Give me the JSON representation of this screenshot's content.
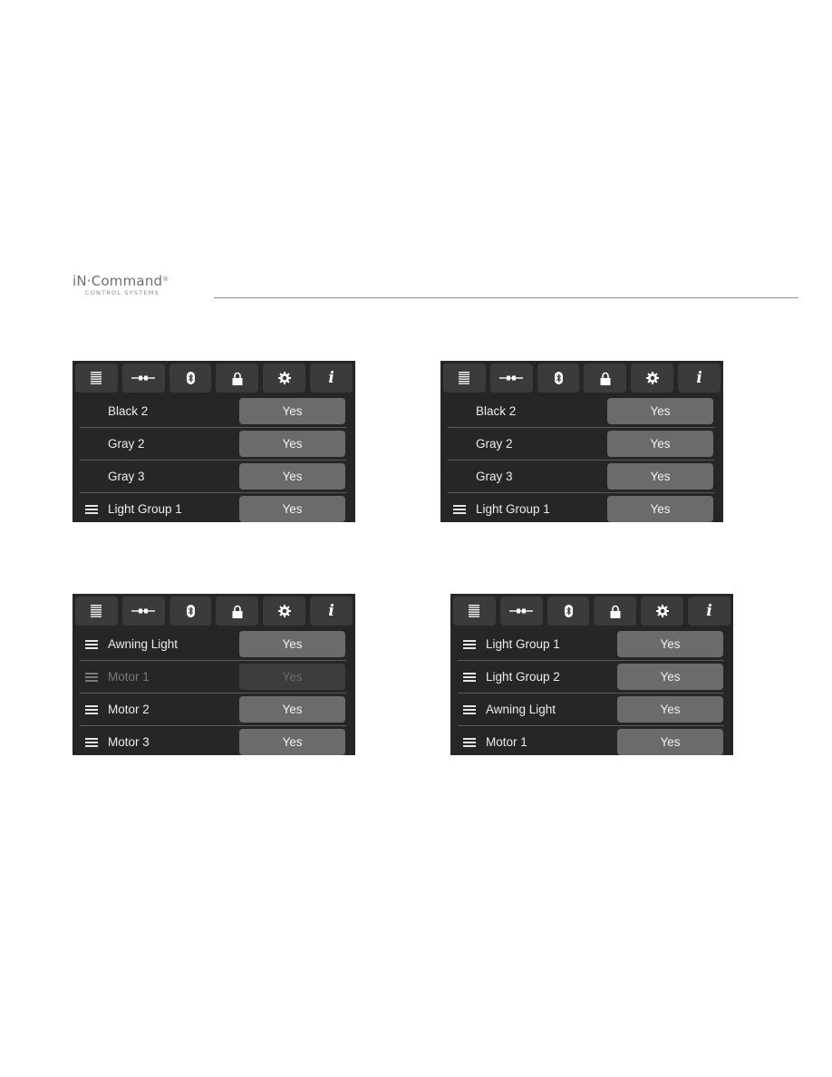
{
  "brand": {
    "name": "iN·Command",
    "registered": "®",
    "subtitle": "CONTROL SYSTEMS"
  },
  "tabs": [
    {
      "icon": "list-icon",
      "active": true
    },
    {
      "icon": "connector-icon",
      "active": false
    },
    {
      "icon": "bluetooth-icon",
      "active": false
    },
    {
      "icon": "lock-icon",
      "active": false
    },
    {
      "icon": "gear-icon",
      "active": false
    },
    {
      "icon": "info-icon",
      "glyph": "i",
      "active": false
    }
  ],
  "panels": [
    {
      "rows": [
        {
          "label": "Black 2",
          "value": "Yes",
          "has_handle": false,
          "disabled": false
        },
        {
          "label": "Gray 2",
          "value": "Yes",
          "has_handle": false,
          "disabled": false
        },
        {
          "label": "Gray 3",
          "value": "Yes",
          "has_handle": false,
          "disabled": false
        },
        {
          "label": "Light Group 1",
          "value": "Yes",
          "has_handle": true,
          "disabled": false
        }
      ]
    },
    {
      "rows": [
        {
          "label": "Black 2",
          "value": "Yes",
          "has_handle": false,
          "disabled": false
        },
        {
          "label": "Gray 2",
          "value": "Yes",
          "has_handle": false,
          "disabled": false
        },
        {
          "label": "Gray 3",
          "value": "Yes",
          "has_handle": false,
          "disabled": false
        },
        {
          "label": "Light Group 1",
          "value": "Yes",
          "has_handle": true,
          "disabled": false
        }
      ]
    },
    {
      "rows": [
        {
          "label": "Awning Light",
          "value": "Yes",
          "has_handle": true,
          "disabled": false
        },
        {
          "label": "Motor 1",
          "value": "Yes",
          "has_handle": true,
          "disabled": true
        },
        {
          "label": "Motor 2",
          "value": "Yes",
          "has_handle": true,
          "disabled": false
        },
        {
          "label": "Motor 3",
          "value": "Yes",
          "has_handle": true,
          "disabled": false
        }
      ]
    },
    {
      "rows": [
        {
          "label": "Light Group 1",
          "value": "Yes",
          "has_handle": true,
          "disabled": false
        },
        {
          "label": "Light Group 2",
          "value": "Yes",
          "has_handle": true,
          "disabled": false
        },
        {
          "label": "Awning Light",
          "value": "Yes",
          "has_handle": true,
          "disabled": false
        },
        {
          "label": "Motor 1",
          "value": "Yes",
          "has_handle": true,
          "disabled": false
        }
      ]
    }
  ],
  "colors": {
    "panel_bg": "#262626",
    "tab_bg": "#3b3b3b",
    "tab_active_bg": "#6a6a6a",
    "button_bg": "#6b6b6b",
    "button_disabled_bg": "#3d3d3d",
    "text": "#ededed",
    "text_disabled": "#7a7a7a"
  }
}
